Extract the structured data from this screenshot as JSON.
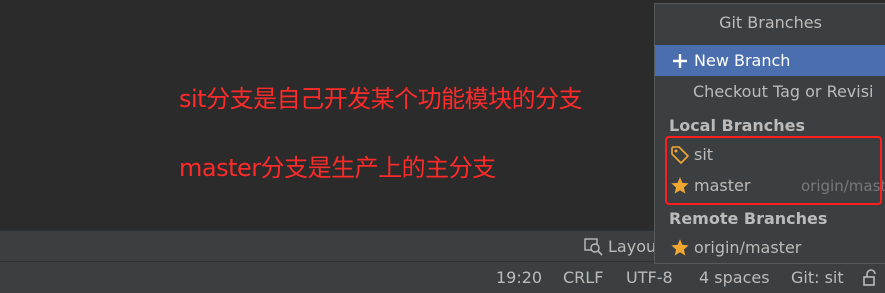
{
  "annotations": {
    "line1": "sit分支是自己开发某个功能模块的分支",
    "line2": "master分支是生产上的主分支"
  },
  "toolbar": {
    "layout_label": "Layou"
  },
  "statusbar": {
    "position": "19:20",
    "line_separator": "CRLF",
    "encoding": "UTF-8",
    "indent": "4 spaces",
    "git_branch": "Git: sit"
  },
  "git_branches_popup": {
    "title": "Git Branches",
    "new_branch_label": "New Branch",
    "checkout_label": "Checkout Tag or Revisi",
    "local_header": "Local Branches",
    "local_branches": [
      {
        "name": "sit",
        "icon": "tag-icon",
        "tracking": ""
      },
      {
        "name": "master",
        "icon": "star-icon",
        "tracking": "origin/mast"
      }
    ],
    "remote_header": "Remote Branches",
    "remote_branches": [
      {
        "name": "origin/master",
        "icon": "star-icon"
      }
    ]
  },
  "colors": {
    "annotation_red": "#ff2a2a",
    "selection_blue": "#4b6eaf",
    "star_gold": "#f0a732",
    "popup_bg": "#3c3f41",
    "editor_bg": "#2b2b2b"
  }
}
